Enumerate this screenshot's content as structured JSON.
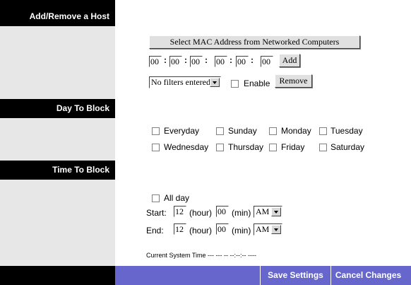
{
  "sections": {
    "host": "Add/Remove a Host",
    "day": "Day To Block",
    "time": "Time To Block"
  },
  "host": {
    "select_mac_label": "Select MAC Address from Networked Computers",
    "mac": [
      "00",
      "00",
      "00",
      "00",
      "00",
      "00"
    ],
    "mac_sep": ":",
    "add_label": "Add",
    "filter_value": "No filters entered.",
    "enable_label": "Enable",
    "remove_label": "Remove"
  },
  "days": {
    "everyday": "Everyday",
    "sunday": "Sunday",
    "monday": "Monday",
    "tuesday": "Tuesday",
    "wednesday": "Wednesday",
    "thursday": "Thursday",
    "friday": "Friday",
    "saturday": "Saturday"
  },
  "time": {
    "all_day": "All day",
    "start_label": "Start:",
    "end_label": "End:",
    "start_hour": "12",
    "start_min": "00",
    "start_ampm": "AM",
    "end_hour": "12",
    "end_min": "00",
    "end_ampm": "AM",
    "hour_unit": "(hour)",
    "min_unit": "(min)"
  },
  "system_time": "Current System Time --- --- -- --:--:-- ----",
  "footer": {
    "save": "Save Settings",
    "cancel": "Cancel Changes"
  }
}
